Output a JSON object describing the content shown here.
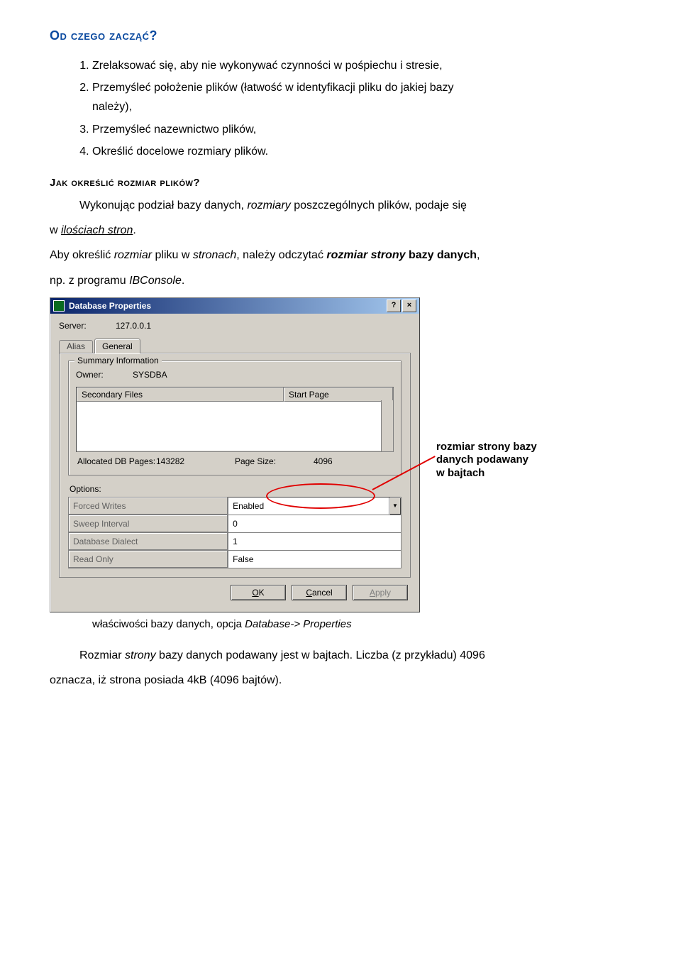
{
  "document": {
    "title1": "Od czego zacząć?",
    "list1": {
      "i1": "Zrelaksować się, aby nie wykonywać czynności w pośpiechu i stresie,",
      "i2_a": "Przemyśleć położenie plików (łatwość w identyfikacji pliku do jakiej bazy",
      "i2_b": "należy),",
      "i3": "Przemyśleć nazewnictwo plików,",
      "i4": "Określić docelowe rozmiary plików."
    },
    "title2": "Jak określić rozmiar plików?",
    "p1_a": "Wykonując podział bazy danych, ",
    "p1_b_ital": "rozmiary",
    "p1_c": " poszczególnych plików, podaje się",
    "p1_d": "w ",
    "p1_e_ital": "ilościach stron",
    "p1_f": ".",
    "p2_a": "Aby określić ",
    "p2_b_ital": "rozmiar",
    "p2_c": " pliku w ",
    "p2_d_ital": "stronach",
    "p2_e": ", należy odczytać ",
    "p2_f_bi": "rozmiar strony",
    "p2_g_bold": " bazy danych",
    "p2_h": ",",
    "p2_i": "np. z programu ",
    "p2_j_ital": "IBConsole",
    "p2_k": ".",
    "callout1": "rozmiar strony bazy",
    "callout2": "danych podawany",
    "callout3": "w bajtach",
    "caption_a": "właściwości bazy danych, opcja ",
    "caption_b_ital": "Database-> Properties",
    "p3_a": "Rozmiar ",
    "p3_b_ital": "strony",
    "p3_c": " bazy danych podawany jest w bajtach. Liczba (z przykładu) 4096",
    "p3_d": "oznacza, iż strona posiada 4kB (4096 bajtów)."
  },
  "dialog": {
    "title": "Database Properties",
    "help_btn": "?",
    "close_btn": "×",
    "server_label": "Server:",
    "server_value": "127.0.0.1",
    "tabs": {
      "alias": "Alias",
      "general": "General"
    },
    "group_summary": "Summary Information",
    "owner_label": "Owner:",
    "owner_value": "SYSDBA",
    "col_secondary": "Secondary Files",
    "col_startpage": "Start Page",
    "allocated_label": "Allocated DB Pages:",
    "allocated_value": "143282",
    "pagesize_label": "Page Size:",
    "pagesize_value": "4096",
    "options_label": "Options:",
    "opt": {
      "fw": "Forced Writes",
      "fw_v": "Enabled",
      "si": "Sweep Interval",
      "si_v": "0",
      "dd": "Database Dialect",
      "dd_v": "1",
      "ro": "Read Only",
      "ro_v": "False"
    },
    "buttons": {
      "ok": "OK",
      "cancel": "Cancel",
      "apply": "Apply"
    }
  }
}
